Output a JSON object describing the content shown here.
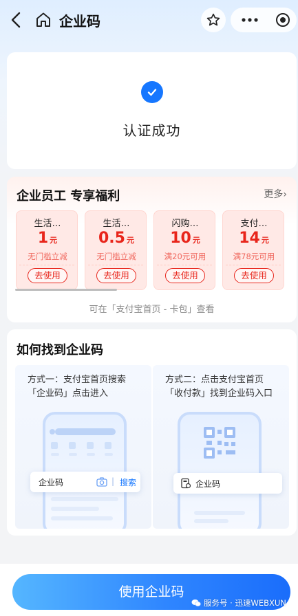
{
  "nav": {
    "title": "企业码"
  },
  "status": {
    "text": "认证成功"
  },
  "benefits": {
    "title": "企业员工 专享福利",
    "more": "更多›",
    "hint": "可在「支付宝首页 - 卡包」查看",
    "coupons": [
      {
        "name": "生活…",
        "amount": "1",
        "unit": "元",
        "desc": "无门槛立减",
        "button": "去使用"
      },
      {
        "name": "生活…",
        "amount": "0.5",
        "unit": "元",
        "desc": "无门槛立减",
        "button": "去使用"
      },
      {
        "name": "闪购…",
        "amount": "10",
        "unit": "元",
        "desc": "满20元可用",
        "button": "去使用"
      },
      {
        "name": "支付…",
        "amount": "14",
        "unit": "元",
        "desc": "满78元可用",
        "button": "去使用"
      }
    ]
  },
  "how": {
    "title": "如何找到企业码",
    "method1": {
      "line1": "方式一：支付宝首页搜索",
      "line2": "「企业码」点击进入",
      "search_text": "企业码",
      "search_button": "搜索"
    },
    "method2": {
      "line1": "方式二：点击支付宝首页",
      "line2": "「收付款」找到企业码入口",
      "entry_text": "企业码"
    }
  },
  "action": {
    "button": "使用企业码"
  },
  "watermark": {
    "text": "服务号 · 迅速WEBXUN"
  },
  "colors": {
    "accent": "#1677ff",
    "coupon_red": "#e8251b"
  }
}
